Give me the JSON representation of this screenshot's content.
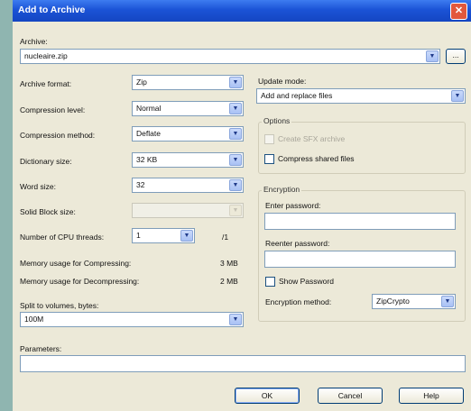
{
  "window": {
    "title": "Add to Archive",
    "close_glyph": "✕"
  },
  "archive": {
    "label": "Archive:",
    "value": "nucleaire.zip",
    "browse_label": "..."
  },
  "left": {
    "format": {
      "label": "Archive format:",
      "value": "Zip"
    },
    "level": {
      "label": "Compression level:",
      "value": "Normal"
    },
    "method": {
      "label": "Compression method:",
      "value": "Deflate"
    },
    "dict": {
      "label": "Dictionary size:",
      "value": "32 KB"
    },
    "word": {
      "label": "Word size:",
      "value": "32"
    },
    "solid": {
      "label": "Solid Block size:",
      "value": ""
    },
    "threads": {
      "label": "Number of CPU threads:",
      "value": "1",
      "max": "/1"
    },
    "mem_comp": {
      "label": "Memory usage for Compressing:",
      "value": "3 MB"
    },
    "mem_decomp": {
      "label": "Memory usage for Decompressing:",
      "value": "2 MB"
    },
    "split": {
      "label": "Split to volumes, bytes:",
      "value": "100M"
    }
  },
  "right": {
    "update": {
      "label": "Update mode:",
      "value": "Add and replace files"
    },
    "options": {
      "title": "Options",
      "sfx": {
        "label": "Create SFX archive",
        "checked": false,
        "enabled": false
      },
      "shared": {
        "label": "Compress shared files",
        "checked": false
      }
    },
    "encryption": {
      "title": "Encryption",
      "enter_label": "Enter password:",
      "enter_value": "",
      "reenter_label": "Reenter password:",
      "reenter_value": "",
      "show": {
        "label": "Show Password",
        "checked": false
      },
      "method_label": "Encryption method:",
      "method_value": "ZipCrypto"
    }
  },
  "parameters": {
    "label": "Parameters:",
    "value": ""
  },
  "buttons": {
    "ok": "OK",
    "cancel": "Cancel",
    "help": "Help"
  },
  "icons": {
    "dropdown": "chevron-down-icon",
    "close": "close-icon"
  },
  "colors": {
    "titlebar": "#1b53d6",
    "dialog": "#ece9d8",
    "close": "#e2583c",
    "backdrop": "#8fb5b0"
  }
}
